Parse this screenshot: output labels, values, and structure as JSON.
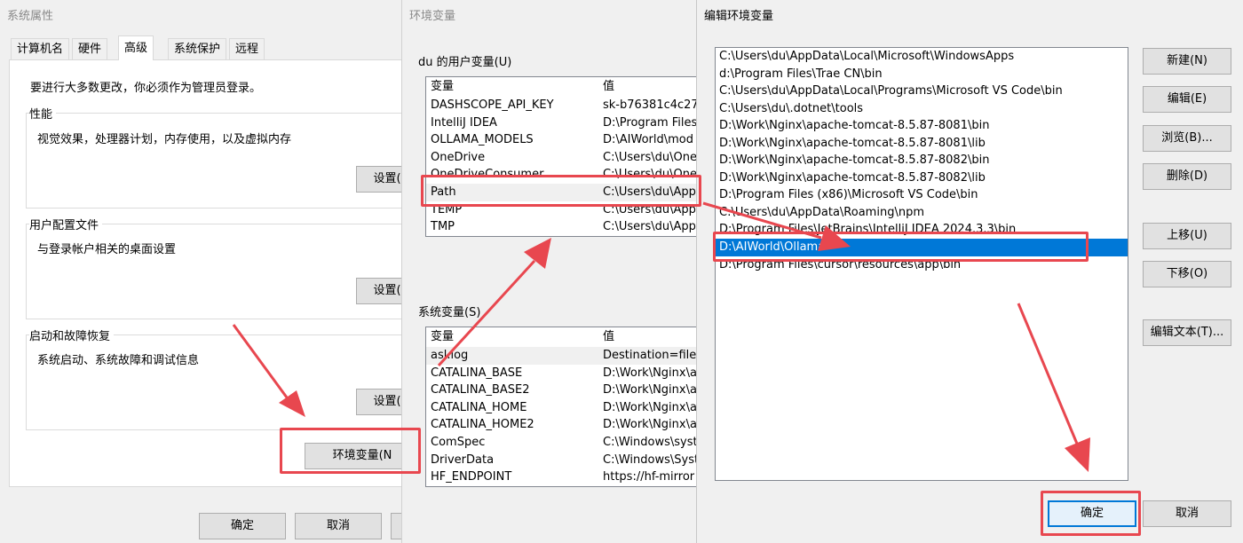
{
  "colors": {
    "annotation_red": "#e8474f",
    "selection_blue": "#0078d7"
  },
  "system_properties": {
    "title": "系统属性",
    "tabs": [
      "计算机名",
      "硬件",
      "高级",
      "系统保护",
      "远程"
    ],
    "active_tab": "高级",
    "admin_note": "要进行大多数更改，你必须作为管理员登录。",
    "performance": {
      "title": "性能",
      "description": "视觉效果，处理器计划，内存使用，以及虚拟内存",
      "button": "设置("
    },
    "user_profiles": {
      "title": "用户配置文件",
      "description": "与登录帐户相关的桌面设置",
      "button": "设置("
    },
    "startup_recovery": {
      "title": "启动和故障恢复",
      "description": "系统启动、系统故障和调试信息",
      "button": "设置("
    },
    "env_button": "环境变量(N",
    "ok_button": "确定",
    "cancel_button": "取消"
  },
  "environment_variables": {
    "title": "环境变量",
    "user_section": "du 的用户变量(U)",
    "system_section": "系统变量(S)",
    "col_variable": "变量",
    "col_value": "值",
    "user_vars": [
      {
        "name": "DASHSCOPE_API_KEY",
        "value": "sk-b76381c4c27"
      },
      {
        "name": "IntelliJ IDEA",
        "value": "D:\\Program Files"
      },
      {
        "name": "OLLAMA_MODELS",
        "value": "D:\\AIWorld\\mod"
      },
      {
        "name": "OneDrive",
        "value": "C:\\Users\\du\\One"
      },
      {
        "name": "OneDriveConsumer",
        "value": "C:\\Users\\du\\One"
      },
      {
        "name": "Path",
        "value": "C:\\Users\\du\\App"
      },
      {
        "name": "TEMP",
        "value": "C:\\Users\\du\\App"
      },
      {
        "name": "TMP",
        "value": "C:\\Users\\du\\App"
      }
    ],
    "system_vars": [
      {
        "name": "asl.log",
        "value": "Destination=file"
      },
      {
        "name": "CATALINA_BASE",
        "value": "D:\\Work\\Nginx\\a"
      },
      {
        "name": "CATALINA_BASE2",
        "value": "D:\\Work\\Nginx\\a"
      },
      {
        "name": "CATALINA_HOME",
        "value": "D:\\Work\\Nginx\\a"
      },
      {
        "name": "CATALINA_HOME2",
        "value": "D:\\Work\\Nginx\\a"
      },
      {
        "name": "ComSpec",
        "value": "C:\\Windows\\syst"
      },
      {
        "name": "DriverData",
        "value": "C:\\Windows\\Syst"
      },
      {
        "name": "HF_ENDPOINT",
        "value": "https://hf-mirror"
      }
    ]
  },
  "edit_env_var": {
    "title": "编辑环境变量",
    "entries": [
      "C:\\Users\\du\\AppData\\Local\\Microsoft\\WindowsApps",
      "d:\\Program Files\\Trae CN\\bin",
      "C:\\Users\\du\\AppData\\Local\\Programs\\Microsoft VS Code\\bin",
      "C:\\Users\\du\\.dotnet\\tools",
      "D:\\Work\\Nginx\\apache-tomcat-8.5.87-8081\\bin",
      "D:\\Work\\Nginx\\apache-tomcat-8.5.87-8081\\lib",
      "D:\\Work\\Nginx\\apache-tomcat-8.5.87-8082\\bin",
      "D:\\Work\\Nginx\\apache-tomcat-8.5.87-8082\\lib",
      "D:\\Program Files (x86)\\Microsoft VS Code\\bin",
      "C:\\Users\\du\\AppData\\Roaming\\npm",
      "D:\\Program Files\\JetBrains\\IntelliJ IDEA 2024.3.3\\bin",
      "D:\\AIWorld\\Ollama",
      "D:\\Program Files\\cursor\\resources\\app\\bin"
    ],
    "selected_entry": "D:\\AIWorld\\Ollama",
    "buttons": {
      "new": "新建(N)",
      "edit": "编辑(E)",
      "browse": "浏览(B)...",
      "delete": "删除(D)",
      "move_up": "上移(U)",
      "move_down": "下移(O)",
      "edit_text": "编辑文本(T)..."
    },
    "ok_button": "确定",
    "cancel_button": "取消"
  }
}
